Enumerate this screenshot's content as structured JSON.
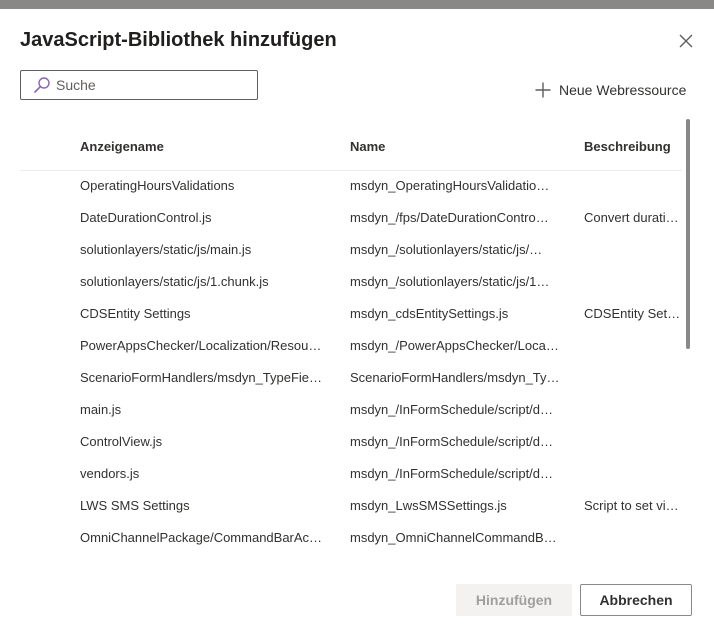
{
  "dialog": {
    "title": "JavaScript-Bibliothek hinzufügen"
  },
  "search": {
    "placeholder": "Suche",
    "value": ""
  },
  "toolbar": {
    "new_resource_label": "Neue Webressource"
  },
  "table": {
    "columns": [
      "Anzeigename",
      "Name",
      "Beschreibung"
    ],
    "rows": [
      {
        "display": "OperatingHoursValidations",
        "name": "msdyn_OperatingHoursValidatio…",
        "desc": ""
      },
      {
        "display": "DateDurationControl.js",
        "name": "msdyn_/fps/DateDurationContro…",
        "desc": "Convert durati…"
      },
      {
        "display": "solutionlayers/static/js/main.js",
        "name": "msdyn_/solutionlayers/static/js/…",
        "desc": ""
      },
      {
        "display": "solutionlayers/static/js/1.chunk.js",
        "name": "msdyn_/solutionlayers/static/js/1…",
        "desc": ""
      },
      {
        "display": "CDSEntity Settings",
        "name": "msdyn_cdsEntitySettings.js",
        "desc": "CDSEntity Sett…"
      },
      {
        "display": "PowerAppsChecker/Localization/Resou…",
        "name": "msdyn_/PowerAppsChecker/Loca…",
        "desc": ""
      },
      {
        "display": "ScenarioFormHandlers/msdyn_TypeFie…",
        "name": "ScenarioFormHandlers/msdyn_Ty…",
        "desc": ""
      },
      {
        "display": "main.js",
        "name": "msdyn_/InFormSchedule/script/d…",
        "desc": ""
      },
      {
        "display": "ControlView.js",
        "name": "msdyn_/InFormSchedule/script/d…",
        "desc": ""
      },
      {
        "display": "vendors.js",
        "name": "msdyn_/InFormSchedule/script/d…",
        "desc": ""
      },
      {
        "display": "LWS SMS Settings",
        "name": "msdyn_LwsSMSSettings.js",
        "desc": "Script to set vi…"
      },
      {
        "display": "OmniChannelPackage/CommandBarAc…",
        "name": "msdyn_OmniChannelCommandB…",
        "desc": ""
      }
    ]
  },
  "footer": {
    "add_label": "Hinzufügen",
    "cancel_label": "Abbrechen",
    "add_disabled": true
  },
  "icons": {
    "search": "search-icon",
    "close": "close-icon",
    "add": "plus-icon"
  },
  "colors": {
    "text": "#323130",
    "disabled_bg": "#f3f2f1",
    "disabled_text": "#a19f9d",
    "search_icon": "#8764b8"
  }
}
